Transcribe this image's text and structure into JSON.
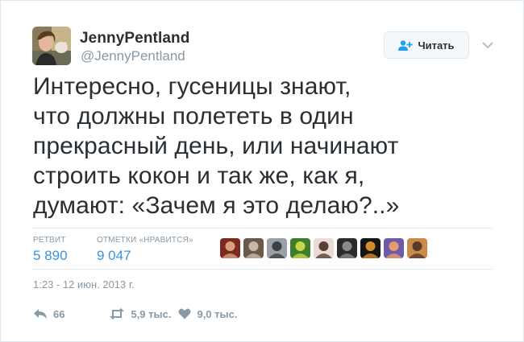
{
  "author": {
    "display_name": "JennyPentland",
    "screen_name": "@JennyPentland",
    "avatar_icon": "user-avatar-photo"
  },
  "follow_button": {
    "label": "Читать",
    "icon": "add-user-icon"
  },
  "tweet": {
    "text": "Интересно, гусеницы знают,\nчто должны полететь в один\nпрекрасный день, или начинают\nстроить кокон и так же, как я,\nдумают: «Зачем я это делаю?..»"
  },
  "stats": {
    "retweets_label": "РЕТВИТ",
    "retweets_value": "5 890",
    "likes_label": "ОТМЕТКИ «НРАВИТСЯ»",
    "likes_value": "9 047"
  },
  "likers": [
    {
      "name": "liker-avatar-1",
      "colors": [
        "#7a2a1e",
        "#d9a07a"
      ]
    },
    {
      "name": "liker-avatar-2",
      "colors": [
        "#6b5a4a",
        "#c9b8a8"
      ]
    },
    {
      "name": "liker-avatar-3",
      "colors": [
        "#9aa0a6",
        "#3c4043"
      ]
    },
    {
      "name": "liker-avatar-4",
      "colors": [
        "#3e7d2a",
        "#c8d64a"
      ]
    },
    {
      "name": "liker-avatar-5",
      "colors": [
        "#e8dcd5",
        "#5a3f35"
      ]
    },
    {
      "name": "liker-avatar-6",
      "colors": [
        "#2b2b2b",
        "#8a8a8a"
      ]
    },
    {
      "name": "liker-avatar-7",
      "colors": [
        "#151515",
        "#d38a28"
      ]
    },
    {
      "name": "liker-avatar-8",
      "colors": [
        "#6e5aa8",
        "#e59a6a"
      ]
    },
    {
      "name": "liker-avatar-9",
      "colors": [
        "#c98a4a",
        "#5a3a2a"
      ]
    }
  ],
  "timestamp": "1:23 - 12 июн. 2013 г.",
  "actions": {
    "reply_count": "66",
    "retweet_count": "5,9 тыс.",
    "like_count": "9,0 тыс."
  },
  "colors": {
    "text": "#292f33",
    "muted": "#8899a6",
    "accent": "#3b94d9",
    "border": "#e1e8ed"
  }
}
